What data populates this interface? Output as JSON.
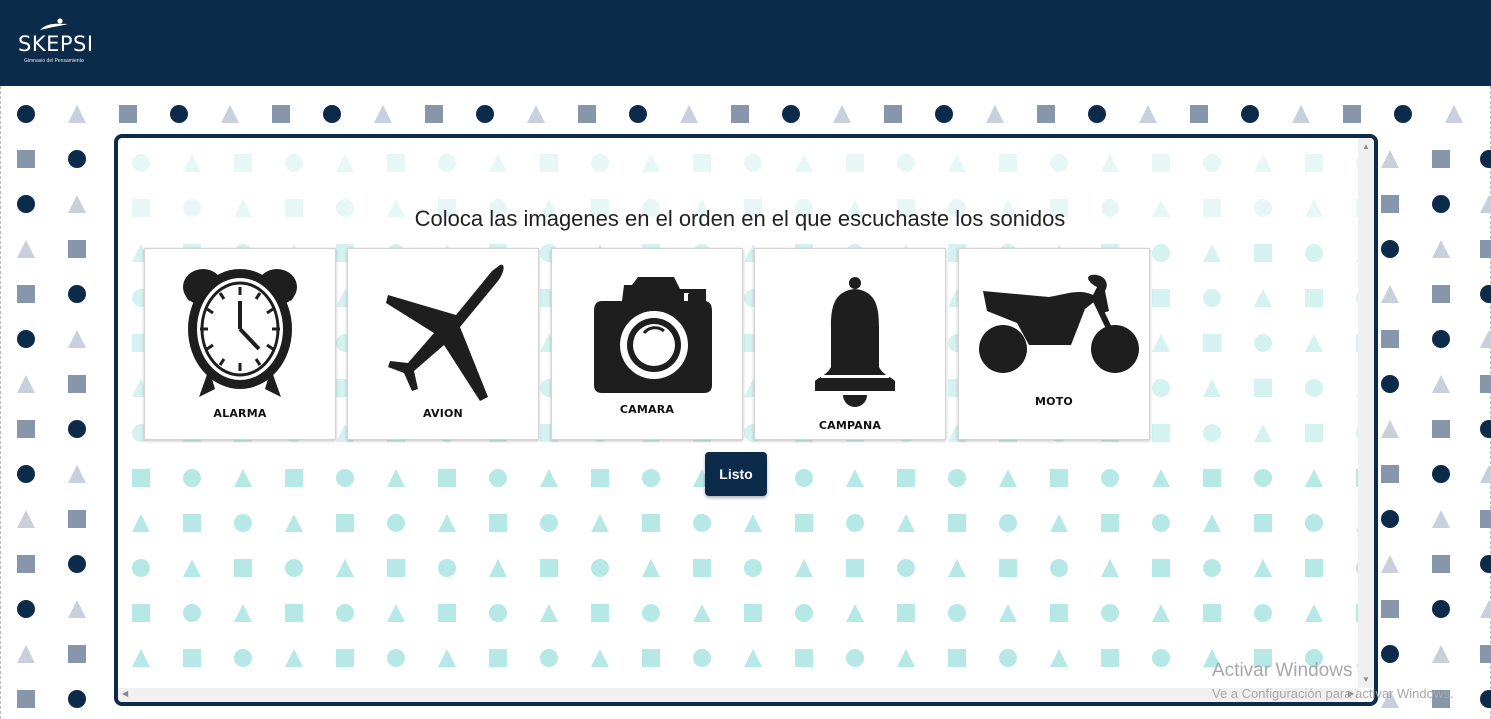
{
  "header": {
    "logo_text": "SKEPSI",
    "logo_tagline": "Gimnasio del Pensamiento"
  },
  "activity": {
    "instruction": "Coloca las imagenes en el orden en el que escuchaste los sonidos",
    "cards": [
      {
        "label": "ALARMA",
        "icon": "alarm-clock-icon"
      },
      {
        "label": "AVION",
        "icon": "airplane-icon"
      },
      {
        "label": "CAMARA",
        "icon": "camera-icon"
      },
      {
        "label": "CAMPANA",
        "icon": "bell-icon"
      },
      {
        "label": "MOTO",
        "icon": "motorcycle-icon"
      }
    ],
    "submit_label": "Listo"
  },
  "watermark": {
    "line1": "Activar Windows",
    "line2": "Ve a Configuración para activar Windows."
  },
  "colors": {
    "brand_navy": "#0c2a4a",
    "pattern_teal": "#b6e9e6",
    "pattern_slate": "#8796ab"
  }
}
